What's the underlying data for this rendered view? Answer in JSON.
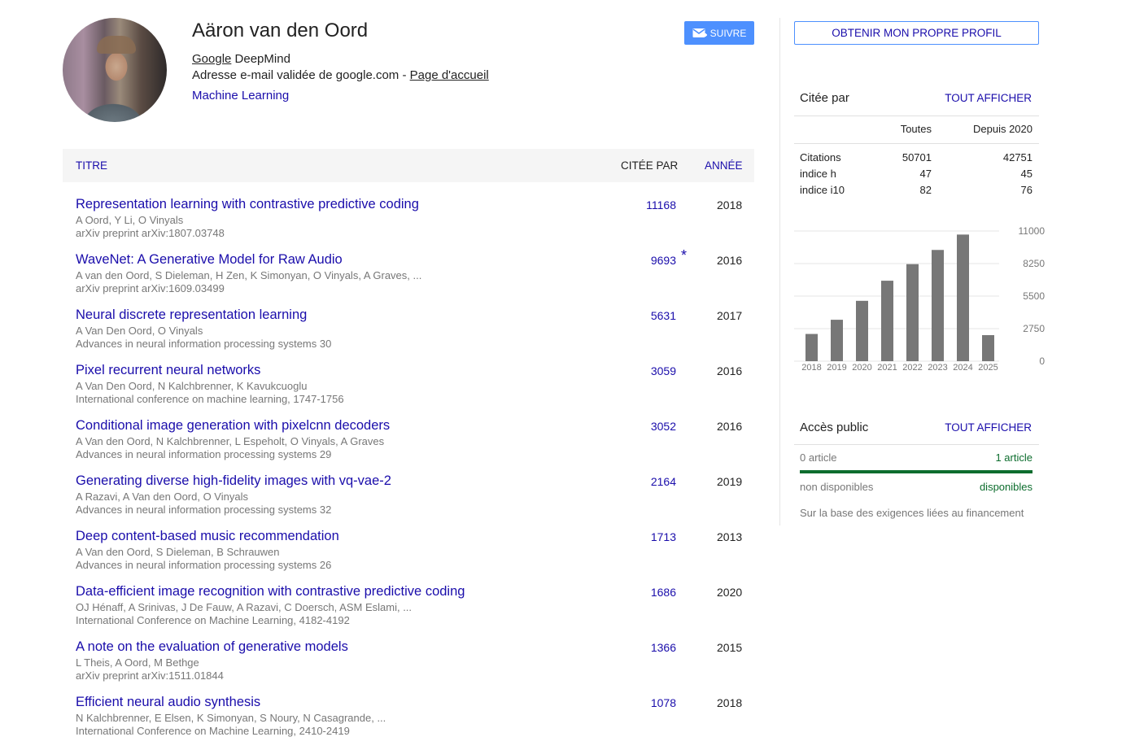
{
  "profile": {
    "name": "Aäron van den Oord",
    "affiliation_link": "Google",
    "affiliation_rest": " DeepMind",
    "email_text": "Adresse e-mail validée de google.com - ",
    "homepage_link": "Page d'accueil",
    "interest": "Machine Learning",
    "follow_label": "SUIVRE",
    "avatar_icon": "avatar-photo"
  },
  "table": {
    "col_title": "TITRE",
    "col_cited": "CITÉE PAR",
    "col_year": "ANNÉE",
    "rows": [
      {
        "title": "Representation learning with contrastive predictive coding",
        "authors": "A Oord, Y Li, O Vinyals",
        "venue": "arXiv preprint arXiv:1807.03748",
        "cited": "11168",
        "star": "",
        "year": "2018"
      },
      {
        "title": "WaveNet: A Generative Model for Raw Audio",
        "authors": "A van den Oord, S Dieleman, H Zen, K Simonyan, O Vinyals, A Graves, ...",
        "venue": "arXiv preprint arXiv:1609.03499",
        "cited": "9693",
        "star": "*",
        "year": "2016"
      },
      {
        "title": "Neural discrete representation learning",
        "authors": "A Van Den Oord, O Vinyals",
        "venue": "Advances in neural information processing systems 30",
        "cited": "5631",
        "star": "",
        "year": "2017"
      },
      {
        "title": "Pixel recurrent neural networks",
        "authors": "A Van Den Oord, N Kalchbrenner, K Kavukcuoglu",
        "venue": "International conference on machine learning, 1747-1756",
        "cited": "3059",
        "star": "",
        "year": "2016"
      },
      {
        "title": "Conditional image generation with pixelcnn decoders",
        "authors": "A Van den Oord, N Kalchbrenner, L Espeholt, O Vinyals, A Graves",
        "venue": "Advances in neural information processing systems 29",
        "cited": "3052",
        "star": "",
        "year": "2016"
      },
      {
        "title": "Generating diverse high-fidelity images with vq-vae-2",
        "authors": "A Razavi, A Van den Oord, O Vinyals",
        "venue": "Advances in neural information processing systems 32",
        "cited": "2164",
        "star": "",
        "year": "2019"
      },
      {
        "title": "Deep content-based music recommendation",
        "authors": "A Van den Oord, S Dieleman, B Schrauwen",
        "venue": "Advances in neural information processing systems 26",
        "cited": "1713",
        "star": "",
        "year": "2013"
      },
      {
        "title": "Data-efficient image recognition with contrastive predictive coding",
        "authors": "OJ Hénaff, A Srinivas, J De Fauw, A Razavi, C Doersch, ASM Eslami, ...",
        "venue": "International Conference on Machine Learning, 4182-4192",
        "cited": "1686",
        "star": "",
        "year": "2020"
      },
      {
        "title": "A note on the evaluation of generative models",
        "authors": "L Theis, A Oord, M Bethge",
        "venue": "arXiv preprint arXiv:1511.01844",
        "cited": "1366",
        "star": "",
        "year": "2015"
      },
      {
        "title": "Efficient neural audio synthesis",
        "authors": "N Kalchbrenner, E Elsen, K Simonyan, S Noury, N Casagrande, ...",
        "venue": "International Conference on Machine Learning, 2410-2419",
        "cited": "1078",
        "star": "",
        "year": "2018"
      }
    ]
  },
  "sidebar": {
    "own_profile_label": "OBTENIR MON PROPRE PROFIL",
    "cited_by": {
      "title": "Citée par",
      "link": "TOUT AFFICHER",
      "head_all": "Toutes",
      "head_since": "Depuis 2020",
      "rows": [
        {
          "label": "Citations",
          "all": "50701",
          "since": "42751"
        },
        {
          "label": "indice h",
          "all": "47",
          "since": "45"
        },
        {
          "label": "indice i10",
          "all": "82",
          "since": "76"
        }
      ]
    },
    "public_access": {
      "title": "Accès public",
      "link": "TOUT AFFICHER",
      "left_count": "0 article",
      "right_count": "1 article",
      "left_label": "non disponibles",
      "right_label": "disponibles",
      "note": "Sur la base des exigences liées au financement",
      "available_fraction": 1.0,
      "available_color": "#0d6d2e"
    }
  },
  "chart_data": {
    "type": "bar",
    "categories": [
      "2018",
      "2019",
      "2020",
      "2021",
      "2022",
      "2023",
      "2024",
      "2025"
    ],
    "values": [
      2300,
      3500,
      5100,
      6800,
      8200,
      9400,
      10700,
      2200
    ],
    "yticks": [
      "11000",
      "8250",
      "5500",
      "2750",
      "0"
    ],
    "ylim": [
      0,
      11000
    ],
    "bar_color": "#777777",
    "grid": true
  },
  "colors": {
    "link": "#1a0dab",
    "accent_button": "#4d90fe"
  }
}
